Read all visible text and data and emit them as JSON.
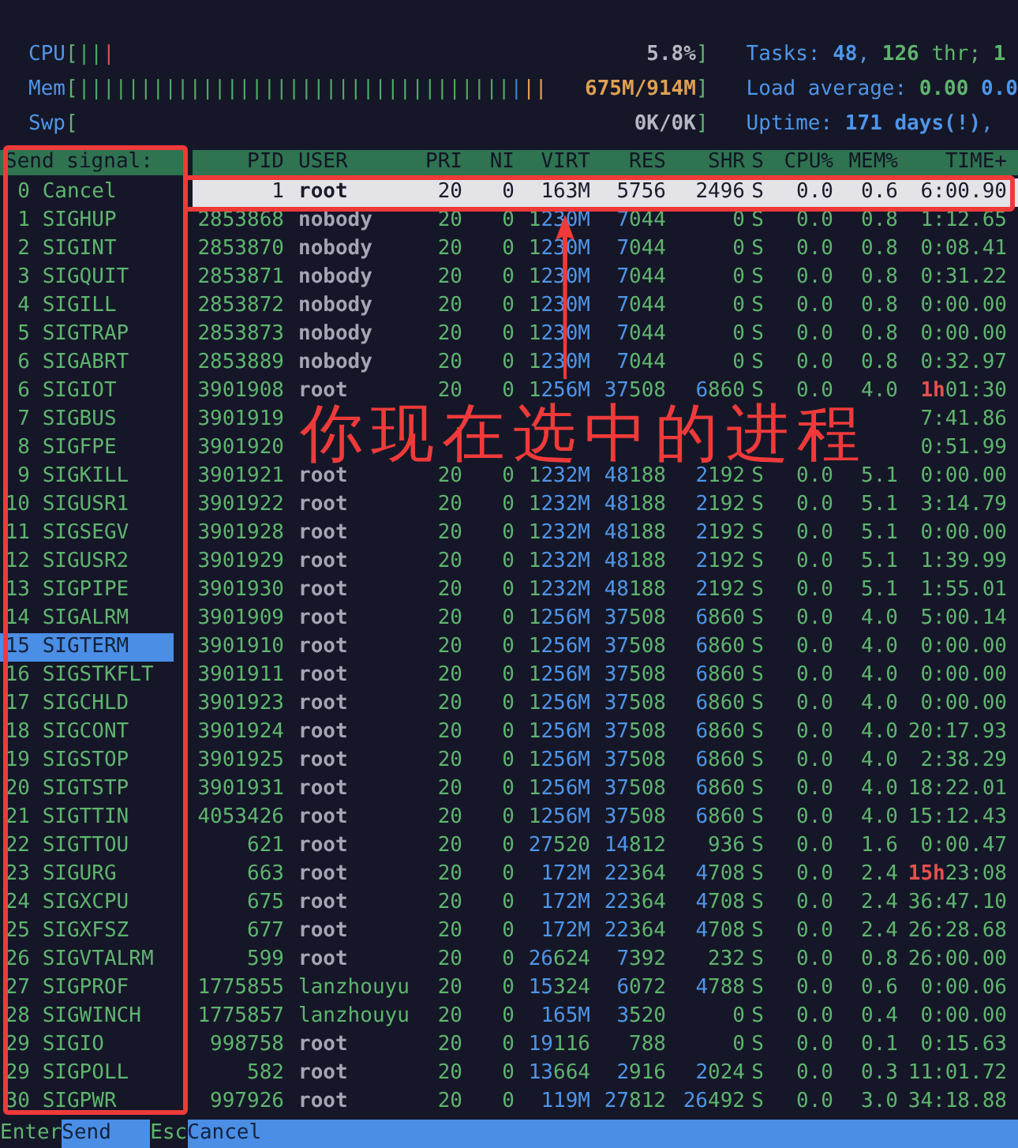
{
  "meters": [
    {
      "label": "CPU",
      "open": "[",
      "close": "]",
      "bars": [
        {
          "text": "||",
          "color": "#4fa863"
        },
        {
          "text": "|",
          "color": "#d9534f"
        }
      ],
      "value": {
        "text": "5.8%",
        "color": "#b4b6c2"
      }
    },
    {
      "label": "Mem",
      "open": "[",
      "close": "]",
      "bars": [
        {
          "text": "|||||||||||||||||||||||||||||||||||",
          "color": "#4fa863"
        },
        {
          "text": "|",
          "color": "#3f7fd0"
        },
        {
          "text": "||",
          "color": "#e0a050"
        }
      ],
      "value": {
        "text": "675M/914M",
        "color": "#e0a050"
      }
    },
    {
      "label": "Swp",
      "open": "[",
      "close": "]",
      "value": {
        "text": "0K/0K",
        "color": "#b4b6c2"
      }
    }
  ],
  "info": [
    {
      "segments": [
        {
          "kind": "label",
          "text": "Tasks: "
        },
        {
          "kind": "num",
          "text": "48"
        },
        {
          "kind": "label",
          "text": ", "
        },
        {
          "kind": "num2",
          "text": "126"
        },
        {
          "kind": "text",
          "text": " thr; "
        },
        {
          "kind": "num2",
          "text": "1"
        }
      ]
    },
    {
      "segments": [
        {
          "kind": "label",
          "text": "Load average: "
        },
        {
          "kind": "num2",
          "text": "0.00"
        },
        {
          "kind": "num",
          "text": " 0.0"
        }
      ]
    },
    {
      "segments": [
        {
          "kind": "label",
          "text": "Uptime: "
        },
        {
          "kind": "num",
          "text": "171 days(!)"
        },
        {
          "kind": "label",
          "text": ","
        }
      ]
    }
  ],
  "signal_panel": {
    "title": "Send signal:",
    "items": [
      {
        "number": "0",
        "name": "Cancel",
        "selected": false
      },
      {
        "number": "1",
        "name": "SIGHUP",
        "selected": false
      },
      {
        "number": "2",
        "name": "SIGINT",
        "selected": false
      },
      {
        "number": "3",
        "name": "SIGQUIT",
        "selected": false
      },
      {
        "number": "4",
        "name": "SIGILL",
        "selected": false
      },
      {
        "number": "5",
        "name": "SIGTRAP",
        "selected": false
      },
      {
        "number": "6",
        "name": "SIGABRT",
        "selected": false
      },
      {
        "number": "6",
        "name": "SIGIOT",
        "selected": false
      },
      {
        "number": "7",
        "name": "SIGBUS",
        "selected": false
      },
      {
        "number": "8",
        "name": "SIGFPE",
        "selected": false
      },
      {
        "number": "9",
        "name": "SIGKILL",
        "selected": false
      },
      {
        "number": "10",
        "name": "SIGUSR1",
        "selected": false
      },
      {
        "number": "11",
        "name": "SIGSEGV",
        "selected": false
      },
      {
        "number": "12",
        "name": "SIGUSR2",
        "selected": false
      },
      {
        "number": "13",
        "name": "SIGPIPE",
        "selected": false
      },
      {
        "number": "14",
        "name": "SIGALRM",
        "selected": false
      },
      {
        "number": "15",
        "name": "SIGTERM",
        "selected": true
      },
      {
        "number": "16",
        "name": "SIGSTKFLT",
        "selected": false
      },
      {
        "number": "17",
        "name": "SIGCHLD",
        "selected": false
      },
      {
        "number": "18",
        "name": "SIGCONT",
        "selected": false
      },
      {
        "number": "19",
        "name": "SIGSTOP",
        "selected": false
      },
      {
        "number": "20",
        "name": "SIGTSTP",
        "selected": false
      },
      {
        "number": "21",
        "name": "SIGTTIN",
        "selected": false
      },
      {
        "number": "22",
        "name": "SIGTTOU",
        "selected": false
      },
      {
        "number": "23",
        "name": "SIGURG",
        "selected": false
      },
      {
        "number": "24",
        "name": "SIGXCPU",
        "selected": false
      },
      {
        "number": "25",
        "name": "SIGXFSZ",
        "selected": false
      },
      {
        "number": "26",
        "name": "SIGVTALRM",
        "selected": false
      },
      {
        "number": "27",
        "name": "SIGPROF",
        "selected": false
      },
      {
        "number": "28",
        "name": "SIGWINCH",
        "selected": false
      },
      {
        "number": "29",
        "name": "SIGIO",
        "selected": false
      },
      {
        "number": "29",
        "name": "SIGPOLL",
        "selected": false
      },
      {
        "number": "30",
        "name": "SIGPWR",
        "selected": false
      }
    ]
  },
  "table": {
    "columns": [
      "PID",
      "USER",
      "PRI",
      "NI",
      "VIRT",
      "RES",
      "SHR",
      "S",
      "CPU%",
      "MEM%",
      "TIME+"
    ],
    "rows": [
      {
        "cells": [
          "1",
          "root",
          "20",
          "0",
          "163M",
          "5756",
          "2496",
          "S",
          "0.0",
          "0.6",
          "6:00.90"
        ],
        "other_user": true,
        "selected": true
      },
      {
        "cells": [
          "2853868",
          "nobody",
          "20",
          "0",
          "1230M",
          "7044",
          "0",
          "S",
          "0.0",
          "0.8",
          "1:12.65"
        ],
        "other_user": true,
        "selected": false
      },
      {
        "cells": [
          "2853870",
          "nobody",
          "20",
          "0",
          "1230M",
          "7044",
          "0",
          "S",
          "0.0",
          "0.8",
          "0:08.41"
        ],
        "other_user": true,
        "selected": false
      },
      {
        "cells": [
          "2853871",
          "nobody",
          "20",
          "0",
          "1230M",
          "7044",
          "0",
          "S",
          "0.0",
          "0.8",
          "0:31.22"
        ],
        "other_user": true,
        "selected": false
      },
      {
        "cells": [
          "2853872",
          "nobody",
          "20",
          "0",
          "1230M",
          "7044",
          "0",
          "S",
          "0.0",
          "0.8",
          "0:00.00"
        ],
        "other_user": true,
        "selected": false
      },
      {
        "cells": [
          "2853873",
          "nobody",
          "20",
          "0",
          "1230M",
          "7044",
          "0",
          "S",
          "0.0",
          "0.8",
          "0:00.00"
        ],
        "other_user": true,
        "selected": false
      },
      {
        "cells": [
          "2853889",
          "nobody",
          "20",
          "0",
          "1230M",
          "7044",
          "0",
          "S",
          "0.0",
          "0.8",
          "0:32.97"
        ],
        "other_user": true,
        "selected": false
      },
      {
        "cells": [
          "3901908",
          "root",
          "20",
          "0",
          "1256M",
          "37508",
          "6860",
          "S",
          "0.0",
          "4.0",
          "1h01:30"
        ],
        "other_user": true,
        "selected": false
      },
      {
        "cells": [
          "3901919",
          null,
          null,
          null,
          null,
          null,
          null,
          null,
          null,
          null,
          "7:41.86"
        ],
        "selected": false
      },
      {
        "cells": [
          "3901920",
          null,
          null,
          null,
          null,
          null,
          null,
          null,
          null,
          null,
          "0:51.99"
        ],
        "selected": false
      },
      {
        "cells": [
          "3901921",
          "root",
          "20",
          "0",
          "1232M",
          "48188",
          "2192",
          "S",
          "0.0",
          "5.1",
          "0:00.00"
        ],
        "other_user": true,
        "selected": false
      },
      {
        "cells": [
          "3901922",
          "root",
          "20",
          "0",
          "1232M",
          "48188",
          "2192",
          "S",
          "0.0",
          "5.1",
          "3:14.79"
        ],
        "other_user": true,
        "selected": false
      },
      {
        "cells": [
          "3901928",
          "root",
          "20",
          "0",
          "1232M",
          "48188",
          "2192",
          "S",
          "0.0",
          "5.1",
          "0:00.00"
        ],
        "other_user": true,
        "selected": false
      },
      {
        "cells": [
          "3901929",
          "root",
          "20",
          "0",
          "1232M",
          "48188",
          "2192",
          "S",
          "0.0",
          "5.1",
          "1:39.99"
        ],
        "other_user": true,
        "selected": false
      },
      {
        "cells": [
          "3901930",
          "root",
          "20",
          "0",
          "1232M",
          "48188",
          "2192",
          "S",
          "0.0",
          "5.1",
          "1:55.01"
        ],
        "other_user": true,
        "selected": false
      },
      {
        "cells": [
          "3901909",
          "root",
          "20",
          "0",
          "1256M",
          "37508",
          "6860",
          "S",
          "0.0",
          "4.0",
          "5:00.14"
        ],
        "other_user": true,
        "selected": false
      },
      {
        "cells": [
          "3901910",
          "root",
          "20",
          "0",
          "1256M",
          "37508",
          "6860",
          "S",
          "0.0",
          "4.0",
          "0:00.00"
        ],
        "other_user": true,
        "selected": false
      },
      {
        "cells": [
          "3901911",
          "root",
          "20",
          "0",
          "1256M",
          "37508",
          "6860",
          "S",
          "0.0",
          "4.0",
          "0:00.00"
        ],
        "other_user": true,
        "selected": false
      },
      {
        "cells": [
          "3901923",
          "root",
          "20",
          "0",
          "1256M",
          "37508",
          "6860",
          "S",
          "0.0",
          "4.0",
          "0:00.00"
        ],
        "other_user": true,
        "selected": false
      },
      {
        "cells": [
          "3901924",
          "root",
          "20",
          "0",
          "1256M",
          "37508",
          "6860",
          "S",
          "0.0",
          "4.0",
          "20:17.93"
        ],
        "other_user": true,
        "selected": false
      },
      {
        "cells": [
          "3901925",
          "root",
          "20",
          "0",
          "1256M",
          "37508",
          "6860",
          "S",
          "0.0",
          "4.0",
          "2:38.29"
        ],
        "other_user": true,
        "selected": false
      },
      {
        "cells": [
          "3901931",
          "root",
          "20",
          "0",
          "1256M",
          "37508",
          "6860",
          "S",
          "0.0",
          "4.0",
          "18:22.01"
        ],
        "other_user": true,
        "selected": false
      },
      {
        "cells": [
          "4053426",
          "root",
          "20",
          "0",
          "1256M",
          "37508",
          "6860",
          "S",
          "0.0",
          "4.0",
          "15:12.43"
        ],
        "other_user": true,
        "selected": false
      },
      {
        "cells": [
          "621",
          "root",
          "20",
          "0",
          "27520",
          "14812",
          "936",
          "S",
          "0.0",
          "1.6",
          "0:00.47"
        ],
        "other_user": true,
        "selected": false
      },
      {
        "cells": [
          "663",
          "root",
          "20",
          "0",
          "172M",
          "22364",
          "4708",
          "S",
          "0.0",
          "2.4",
          "15h23:08"
        ],
        "other_user": true,
        "selected": false
      },
      {
        "cells": [
          "675",
          "root",
          "20",
          "0",
          "172M",
          "22364",
          "4708",
          "S",
          "0.0",
          "2.4",
          "36:47.10"
        ],
        "other_user": true,
        "selected": false
      },
      {
        "cells": [
          "677",
          "root",
          "20",
          "0",
          "172M",
          "22364",
          "4708",
          "S",
          "0.0",
          "2.4",
          "26:28.68"
        ],
        "other_user": true,
        "selected": false
      },
      {
        "cells": [
          "599",
          "root",
          "20",
          "0",
          "26624",
          "7392",
          "232",
          "S",
          "0.0",
          "0.8",
          "26:00.00"
        ],
        "other_user": true,
        "selected": false
      },
      {
        "cells": [
          "1775855",
          "lanzhouyu",
          "20",
          "0",
          "15324",
          "6072",
          "4788",
          "S",
          "0.0",
          "0.6",
          "0:00.06"
        ],
        "other_user": false,
        "selected": false
      },
      {
        "cells": [
          "1775857",
          "lanzhouyu",
          "20",
          "0",
          "165M",
          "3520",
          "0",
          "S",
          "0.0",
          "0.4",
          "0:00.00"
        ],
        "other_user": false,
        "selected": false
      },
      {
        "cells": [
          "998758",
          "root",
          "20",
          "0",
          "19116",
          "788",
          "0",
          "S",
          "0.0",
          "0.1",
          "0:15.63"
        ],
        "other_user": true,
        "selected": false
      },
      {
        "cells": [
          "582",
          "root",
          "20",
          "0",
          "13664",
          "2916",
          "2024",
          "S",
          "0.0",
          "0.3",
          "11:01.72"
        ],
        "other_user": true,
        "selected": false
      },
      {
        "cells": [
          "997926",
          "root",
          "20",
          "0",
          "119M",
          "27812",
          "26492",
          "S",
          "0.0",
          "3.0",
          "34:18.88"
        ],
        "other_user": true,
        "selected": false
      }
    ]
  },
  "footer": [
    {
      "key": "Enter",
      "label": "Send"
    },
    {
      "key": "Esc",
      "label": "Cancel"
    }
  ],
  "annotation": {
    "label": "你现在选中的进程"
  }
}
